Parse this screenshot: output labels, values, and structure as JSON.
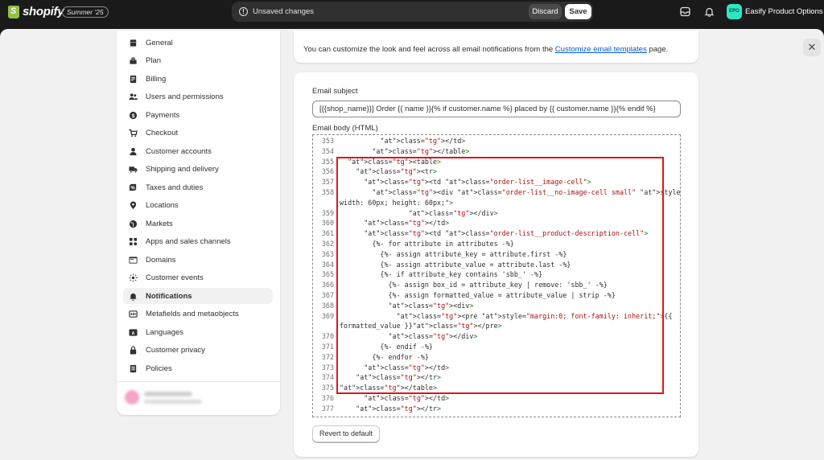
{
  "topbar": {
    "brand": "shopify",
    "edition": "Summer '25",
    "unsaved_text": "Unsaved changes",
    "discard_label": "Discard",
    "save_label": "Save",
    "store_initials": "EPO",
    "store_name": "Easify Product Options"
  },
  "sidebar": {
    "items": [
      {
        "label": "General",
        "icon": "store-icon"
      },
      {
        "label": "Plan",
        "icon": "plan-icon"
      },
      {
        "label": "Billing",
        "icon": "billing-icon"
      },
      {
        "label": "Users and permissions",
        "icon": "users-icon"
      },
      {
        "label": "Payments",
        "icon": "payments-icon"
      },
      {
        "label": "Checkout",
        "icon": "cart-icon"
      },
      {
        "label": "Customer accounts",
        "icon": "person-icon"
      },
      {
        "label": "Shipping and delivery",
        "icon": "truck-icon"
      },
      {
        "label": "Taxes and duties",
        "icon": "tax-icon"
      },
      {
        "label": "Locations",
        "icon": "location-icon"
      },
      {
        "label": "Markets",
        "icon": "globe-icon"
      },
      {
        "label": "Apps and sales channels",
        "icon": "apps-icon"
      },
      {
        "label": "Domains",
        "icon": "domain-icon"
      },
      {
        "label": "Customer events",
        "icon": "events-icon"
      },
      {
        "label": "Notifications",
        "icon": "bell-icon",
        "active": true
      },
      {
        "label": "Metafields and metaobjects",
        "icon": "metafields-icon"
      },
      {
        "label": "Languages",
        "icon": "language-icon"
      },
      {
        "label": "Customer privacy",
        "icon": "lock-icon"
      },
      {
        "label": "Policies",
        "icon": "policies-icon"
      }
    ]
  },
  "info": {
    "text_before": "You can customize the look and feel across all email notifications from the ",
    "link_text": "Customize email templates",
    "text_after": " page."
  },
  "email": {
    "subject_label": "Email subject",
    "subject_value": "[{{shop_name}}] Order {{ name }}{% if customer.name %} placed by {{ customer.name }}{% endif %}",
    "body_label": "Email body (HTML)",
    "revert_label": "Revert to default",
    "code_lines": [
      {
        "n": "353",
        "text": "          </td>"
      },
      {
        "n": "354",
        "text": "        </table>"
      },
      {
        "n": "355",
        "text": "  <table>"
      },
      {
        "n": "356",
        "text": "    <tr>"
      },
      {
        "n": "357",
        "text": "      <td class=\"order-list__image-cell\">"
      },
      {
        "n": "358",
        "text": "        <div class=\"order-list__no-image-cell small\" style=\"border: none;"
      },
      {
        "n": "",
        "text": "width: 60px; height: 60px;\">"
      },
      {
        "n": "359",
        "text": "                 </div>"
      },
      {
        "n": "360",
        "text": "      </td>"
      },
      {
        "n": "361",
        "text": "      <td class=\"order-list__product-description-cell\">"
      },
      {
        "n": "362",
        "text": "        {%- for attribute in attributes -%}"
      },
      {
        "n": "363",
        "text": "          {%- assign attribute_key = attribute.first -%}"
      },
      {
        "n": "364",
        "text": "          {%- assign attribute_value = attribute.last -%}"
      },
      {
        "n": "365",
        "text": "          {%- if attribute_key contains 'sbb_' -%}"
      },
      {
        "n": "366",
        "text": "            {%- assign box_id = attribute_key | remove: 'sbb_' -%}"
      },
      {
        "n": "367",
        "text": "            {%- assign formatted_value = attribute_value | strip -%}"
      },
      {
        "n": "368",
        "text": "            <div>"
      },
      {
        "n": "369",
        "text": "              <pre style=\"margin:0; font-family: inherit;\">{{"
      },
      {
        "n": "",
        "text": "formatted_value }}</pre>"
      },
      {
        "n": "370",
        "text": "            </div>"
      },
      {
        "n": "371",
        "text": "          {%- endif -%}"
      },
      {
        "n": "372",
        "text": "        {%- endfor -%}"
      },
      {
        "n": "373",
        "text": "      </td>"
      },
      {
        "n": "374",
        "text": "    </tr>"
      },
      {
        "n": "375",
        "text": "</table>"
      },
      {
        "n": "376",
        "text": "      </td>"
      },
      {
        "n": "377",
        "text": "    </tr>"
      }
    ]
  },
  "colors": {
    "highlight": "#e0141e",
    "link": "#005bd3",
    "shopify_green": "#95bf47"
  }
}
